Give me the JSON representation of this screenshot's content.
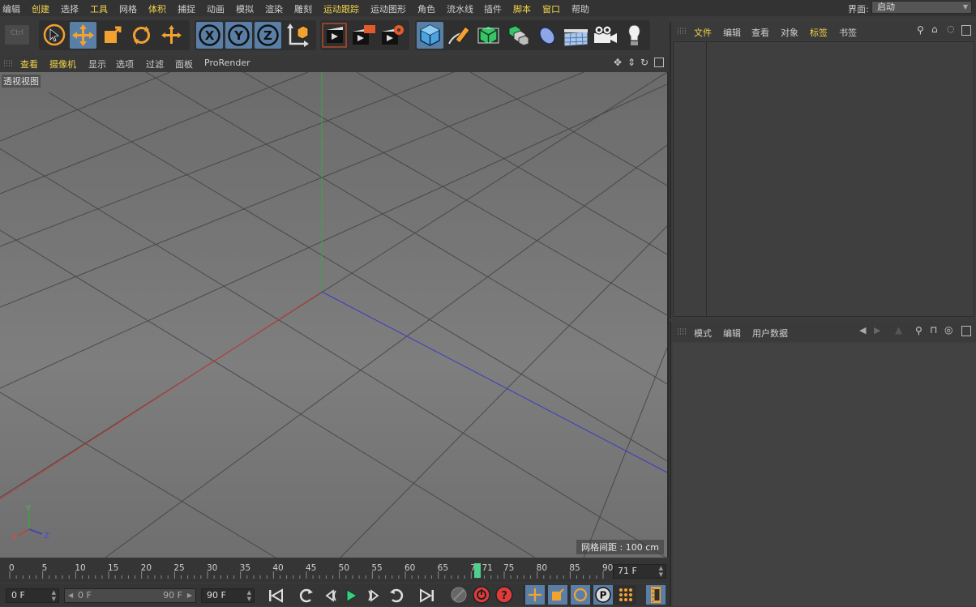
{
  "menubar": {
    "items": [
      {
        "label": "编辑",
        "hl": false
      },
      {
        "label": "创建",
        "hl": true
      },
      {
        "label": "选择",
        "hl": false
      },
      {
        "label": "工具",
        "hl": true
      },
      {
        "label": "网格",
        "hl": false
      },
      {
        "label": "体积",
        "hl": true
      },
      {
        "label": "捕捉",
        "hl": false
      },
      {
        "label": "动画",
        "hl": false
      },
      {
        "label": "模拟",
        "hl": false
      },
      {
        "label": "渲染",
        "hl": false
      },
      {
        "label": "雕刻",
        "hl": false
      },
      {
        "label": "运动跟踪",
        "hl": true
      },
      {
        "label": "运动图形",
        "hl": false
      },
      {
        "label": "角色",
        "hl": false
      },
      {
        "label": "流水线",
        "hl": false
      },
      {
        "label": "插件",
        "hl": false
      },
      {
        "label": "脚本",
        "hl": true
      },
      {
        "label": "窗口",
        "hl": true
      },
      {
        "label": "帮助",
        "hl": false
      }
    ],
    "layout_label": "界面:",
    "layout_value": "启动"
  },
  "toolbar": {
    "undo_label": "Ctrl",
    "icons": [
      "live-select-icon",
      "move-icon",
      "scale-icon",
      "rotate-icon",
      "move-last-icon",
      "x-axis-icon",
      "y-axis-icon",
      "z-axis-icon",
      "coordinate-system-icon",
      "render-view-icon",
      "render-picture-viewer-icon",
      "render-settings-icon",
      "cube-icon",
      "pen-spline-icon",
      "subdivision-surface-icon",
      "cloner-icon",
      "deformer-icon",
      "floor-icon",
      "camera-icon",
      "light-icon"
    ]
  },
  "viewport": {
    "menu": [
      {
        "label": "查看",
        "hl": true
      },
      {
        "label": "摄像机",
        "hl": true
      },
      {
        "label": "显示",
        "hl": false
      },
      {
        "label": "选项",
        "hl": false
      },
      {
        "label": "过滤",
        "hl": false
      },
      {
        "label": "面板",
        "hl": false
      },
      {
        "label": "ProRender",
        "hl": false
      }
    ],
    "view_label": "透视视图",
    "grid_spacing": "网格间距 : 100 cm",
    "axis_x": "X",
    "axis_y": "Y",
    "axis_z": "Z",
    "colors": {
      "x": "#c63b3b",
      "y": "#3aa83a",
      "z": "#3b3bc6"
    }
  },
  "object_manager": {
    "menu": [
      {
        "label": "文件",
        "hl": true
      },
      {
        "label": "编辑",
        "hl": false
      },
      {
        "label": "查看",
        "hl": false
      },
      {
        "label": "对象",
        "hl": false
      },
      {
        "label": "标签",
        "hl": true
      },
      {
        "label": "书签",
        "hl": false
      }
    ]
  },
  "attribute_manager": {
    "menu": [
      "模式",
      "编辑",
      "用户数据"
    ]
  },
  "timeline": {
    "ticks": [
      0,
      5,
      10,
      15,
      20,
      25,
      30,
      35,
      40,
      45,
      50,
      55,
      60,
      65,
      70,
      75,
      80,
      85,
      90
    ],
    "current_frame": 71,
    "current_frame_label": "71",
    "current_frame_field": "71 F",
    "playhead_color": "#4fd08c"
  },
  "transport": {
    "start": "0 F",
    "range_start": "0 F",
    "range_end": "90 F",
    "end": "90 F"
  }
}
